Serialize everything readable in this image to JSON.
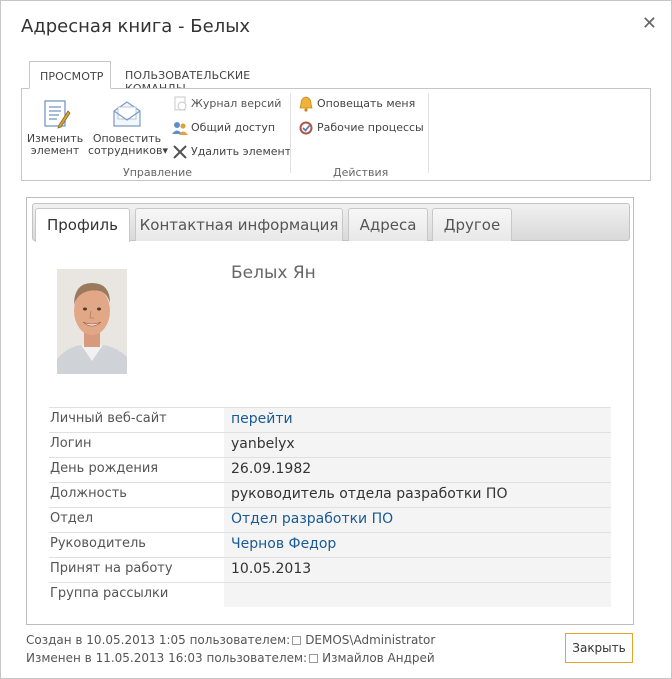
{
  "window": {
    "title": "Адресная книга - Белых",
    "close_glyph": "✕"
  },
  "ribbon": {
    "tabs": [
      "ПРОСМОТР",
      "ПОЛЬЗОВАТЕЛЬСКИЕ КОМАНДЫ"
    ],
    "groups": {
      "manage": {
        "label": "Управление",
        "edit_line1": "Изменить",
        "edit_line2": "элемент",
        "notify_line1": "Оповестить",
        "notify_line2": "сотрудников",
        "notify_arrow": "▾",
        "version_history": "Журнал версий",
        "shared_access": "Общий доступ",
        "delete_item": "Удалить элемент"
      },
      "actions": {
        "label": "Действия",
        "alert_me": "Оповещать меня",
        "workflows": "Рабочие процессы"
      }
    }
  },
  "tabs": [
    "Профиль",
    "Контактная информация",
    "Адреса",
    "Другое"
  ],
  "profile": {
    "name": "Белых Ян",
    "fields": [
      {
        "label": "Личный веб-сайт",
        "value": "перейти",
        "link": true
      },
      {
        "label": "Логин",
        "value": "yanbelyx",
        "link": false
      },
      {
        "label": "День рождения",
        "value": "26.09.1982",
        "link": false
      },
      {
        "label": "Должность",
        "value": "руководитель отдела разработки ПО",
        "link": false
      },
      {
        "label": "Отдел",
        "value": "Отдел разработки ПО",
        "link": true
      },
      {
        "label": "Руководитель",
        "value": "Чернов Федор",
        "link": true
      },
      {
        "label": "Принят на работу",
        "value": "10.05.2013",
        "link": false
      },
      {
        "label": "Группа рассылки",
        "value": "",
        "link": false
      }
    ]
  },
  "footer": {
    "created_prefix": "Создан в 10.05.2013 1:05 пользователем:",
    "created_user": "DEMOS\\Administrator",
    "modified_prefix": "Изменен в 11.05.2013 16:03 пользователем:",
    "modified_user": "Измайлов Андрей",
    "close_button": "Закрыть"
  },
  "colors": {
    "link": "#1a5a94",
    "accent_button_border": "#e4a52d"
  }
}
